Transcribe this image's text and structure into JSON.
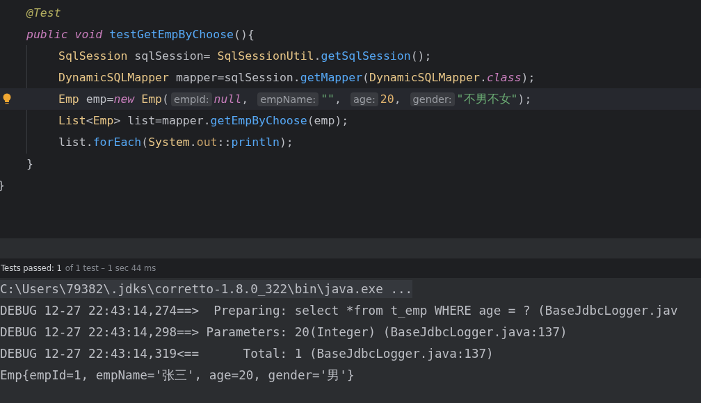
{
  "editor": {
    "lines": [
      {
        "kind": "member",
        "current": false,
        "bulb": false,
        "tokens": [
          {
            "kind": "annotation",
            "text": "@Test"
          }
        ]
      },
      {
        "kind": "member",
        "current": false,
        "bulb": false,
        "tokens": [
          {
            "kind": "keyword",
            "text": "public void"
          },
          {
            "kind": "method",
            "text": " testGetEmpByChoose"
          },
          {
            "kind": "plain",
            "text": "(){"
          }
        ]
      },
      {
        "kind": "body",
        "current": false,
        "bulb": false,
        "tokens": [
          {
            "kind": "type",
            "text": "SqlSession"
          },
          {
            "kind": "plain",
            "text": " sqlSession= "
          },
          {
            "kind": "type",
            "text": "SqlSessionUtil"
          },
          {
            "kind": "plain",
            "text": "."
          },
          {
            "kind": "method",
            "text": "getSqlSession"
          },
          {
            "kind": "plain",
            "text": "();"
          }
        ]
      },
      {
        "kind": "body",
        "current": false,
        "bulb": false,
        "tokens": [
          {
            "kind": "type",
            "text": "DynamicSQLMapper"
          },
          {
            "kind": "plain",
            "text": " mapper=sqlSession."
          },
          {
            "kind": "method",
            "text": "getMapper"
          },
          {
            "kind": "plain",
            "text": "("
          },
          {
            "kind": "type",
            "text": "DynamicSQLMapper"
          },
          {
            "kind": "plain",
            "text": "."
          },
          {
            "kind": "keyword",
            "text": "class"
          },
          {
            "kind": "plain",
            "text": ");"
          }
        ]
      },
      {
        "kind": "body",
        "current": true,
        "bulb": true,
        "tokens": [
          {
            "kind": "type",
            "text": "Emp"
          },
          {
            "kind": "plain",
            "text": " emp="
          },
          {
            "kind": "keyword",
            "text": "new"
          },
          {
            "kind": "type",
            "text": " Emp"
          },
          {
            "kind": "plain",
            "text": "("
          },
          {
            "kind": "hint",
            "text": "empId:"
          },
          {
            "kind": "keyword",
            "text": "null"
          },
          {
            "kind": "plain",
            "text": ", "
          },
          {
            "kind": "hint",
            "text": "empName:"
          },
          {
            "kind": "string",
            "text": "\"\""
          },
          {
            "kind": "plain",
            "text": ", "
          },
          {
            "kind": "hint",
            "text": "age:"
          },
          {
            "kind": "number",
            "text": "20"
          },
          {
            "kind": "plain",
            "text": ", "
          },
          {
            "kind": "hint",
            "text": "gender:"
          },
          {
            "kind": "string",
            "text": "\"不男不女\""
          },
          {
            "kind": "plain",
            "text": ");"
          }
        ]
      },
      {
        "kind": "body",
        "current": false,
        "bulb": false,
        "tokens": [
          {
            "kind": "type",
            "text": "List"
          },
          {
            "kind": "plain",
            "text": "<"
          },
          {
            "kind": "type",
            "text": "Emp"
          },
          {
            "kind": "plain",
            "text": "> list=mapper."
          },
          {
            "kind": "method",
            "text": "getEmpByChoose"
          },
          {
            "kind": "plain",
            "text": "(emp);"
          }
        ]
      },
      {
        "kind": "body",
        "current": false,
        "bulb": false,
        "tokens": [
          {
            "kind": "plain",
            "text": "list."
          },
          {
            "kind": "method",
            "text": "forEach"
          },
          {
            "kind": "plain",
            "text": "("
          },
          {
            "kind": "type",
            "text": "System"
          },
          {
            "kind": "plain",
            "text": "."
          },
          {
            "kind": "field",
            "text": "out"
          },
          {
            "kind": "plain",
            "text": "::"
          },
          {
            "kind": "method",
            "text": "println"
          },
          {
            "kind": "plain",
            "text": ");"
          }
        ]
      },
      {
        "kind": "member",
        "current": false,
        "bulb": false,
        "tokens": [
          {
            "kind": "plain",
            "text": "}"
          }
        ]
      },
      {
        "kind": "outer",
        "current": false,
        "bulb": false,
        "tokens": [
          {
            "kind": "plain",
            "text": "}"
          }
        ]
      }
    ]
  },
  "status_bar": {
    "label": "Tests passed: 1",
    "detail": "of 1 test – 1 sec 44 ms"
  },
  "console": {
    "lines": [
      {
        "text": "C:\\Users\\79382\\.jdks\\corretto-1.8.0_322\\bin\\java.exe ...",
        "current": true
      },
      {
        "text": "DEBUG 12-27 22:43:14,274==>  Preparing: select *from t_emp WHERE age = ? (BaseJdbcLogger.jav",
        "current": false
      },
      {
        "text": "DEBUG 12-27 22:43:14,298==> Parameters: 20(Integer) (BaseJdbcLogger.java:137)",
        "current": false
      },
      {
        "text": "DEBUG 12-27 22:43:14,319<==      Total: 1 (BaseJdbcLogger.java:137)",
        "current": false
      },
      {
        "text": "Emp{empId=1, empName='张三', age=20, gender='男'}",
        "current": false
      }
    ]
  }
}
